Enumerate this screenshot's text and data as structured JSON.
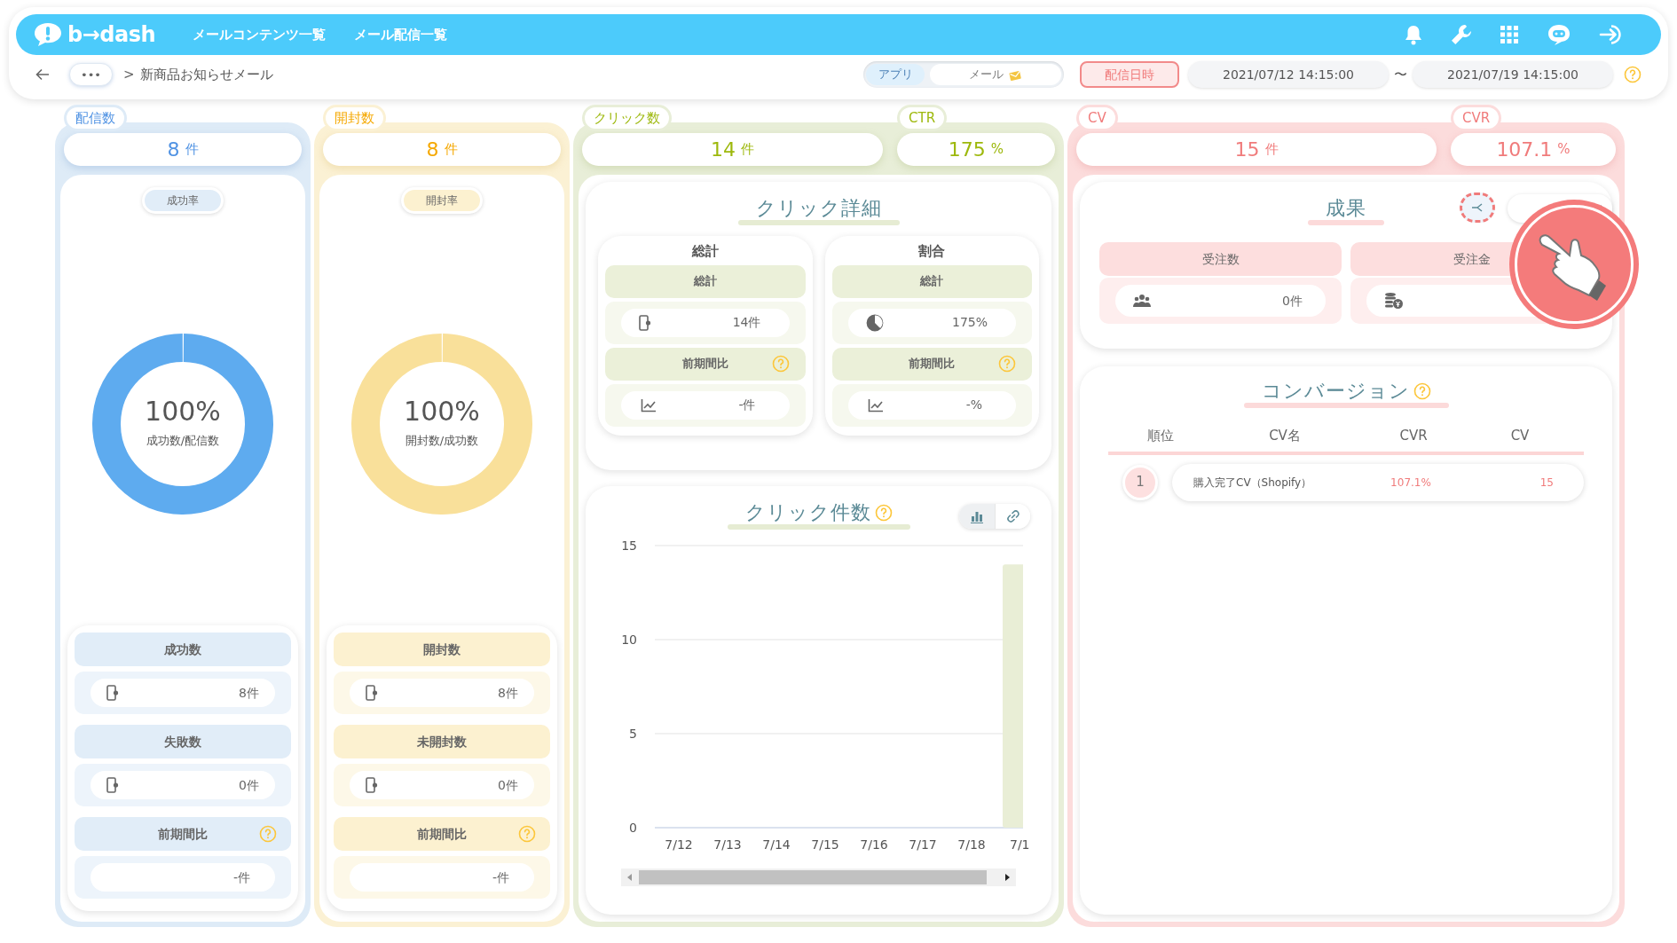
{
  "header": {
    "logo": "b→dash",
    "nav": [
      {
        "label": "メールコンテンツ一覧"
      },
      {
        "label": "メール配信一覧"
      }
    ]
  },
  "breadcrumb": {
    "more": "•••",
    "separator": ">",
    "title": "新商品お知らせメール"
  },
  "channels": [
    {
      "label": "アプリ",
      "selected": true
    },
    {
      "label": "メール",
      "selected": false
    }
  ],
  "period": {
    "button": "配信日時",
    "from": "2021/07/12 14:15:00",
    "separator": "〜",
    "to": "2021/07/19 14:15:00"
  },
  "columns": [
    {
      "kind": "donut",
      "metrics": [
        {
          "label": "配信数",
          "value": "8",
          "unit": "件"
        }
      ],
      "rate_label": "成功率",
      "donut": {
        "level": 1,
        "value": "100%",
        "caption": "成功数/配信数"
      },
      "rows": [
        {
          "kind": "count",
          "label": "成功数",
          "value": "8件"
        },
        {
          "kind": "count",
          "label": "失敗数",
          "value": "0件"
        },
        {
          "kind": "comparison",
          "label": "前期間比",
          "value": "-件"
        }
      ]
    },
    {
      "kind": "donut",
      "metrics": [
        {
          "label": "開封数",
          "value": "8",
          "unit": "件"
        }
      ],
      "rate_label": "開封率",
      "donut": {
        "level": 1,
        "value": "100%",
        "caption": "開封数/成功数"
      },
      "rows": [
        {
          "kind": "count",
          "label": "開封数",
          "value": "8件"
        },
        {
          "kind": "count",
          "label": "未開封数",
          "value": "0件"
        },
        {
          "kind": "comparison",
          "label": "前期間比",
          "value": "-件"
        }
      ]
    },
    {
      "kind": "clicks",
      "metrics": [
        {
          "label": "クリック数",
          "value": "14",
          "unit": "件"
        },
        {
          "label": "CTR",
          "value": "175",
          "unit": "%"
        }
      ],
      "detail": {
        "title": "クリック詳細",
        "groups": [
          {
            "kind": "count",
            "title": "総計",
            "header": "総計",
            "value": "14件",
            "compare_label": "前期間比",
            "compare_value": "-件"
          },
          {
            "kind": "ratio",
            "title": "割合",
            "header": "総計",
            "value": "175%",
            "compare_label": "前期間比",
            "compare_value": "-%"
          }
        ]
      },
      "chart": {
        "views": [
          {
            "kind": "bar",
            "selected": true
          },
          {
            "kind": "link",
            "selected": false
          }
        ],
        "chart_data": {
          "type": "bar",
          "title": "クリック件数",
          "categories": [
            "7/12",
            "7/13",
            "7/14",
            "7/15",
            "7/16",
            "7/17",
            "7/18",
            "7/1"
          ],
          "series": [
            {
              "color": "#e9eed6",
              "values": [
                0,
                0,
                0,
                0,
                0,
                0,
                0,
                14
              ]
            }
          ],
          "ylim": [
            0,
            15
          ],
          "yticks": [
            0,
            5,
            10,
            15
          ]
        }
      }
    },
    {
      "kind": "results",
      "metrics": [
        {
          "label": "CV",
          "value": "15",
          "unit": "件"
        },
        {
          "label": "CVR",
          "value": "107.1",
          "unit": "%"
        }
      ],
      "results": {
        "title": "成果",
        "cards": [
          {
            "kind": "orders",
            "label": "受注数",
            "value": "0件"
          },
          {
            "kind": "sales",
            "label": "受注金"
          }
        ]
      },
      "conversions": {
        "title": "コンバージョン",
        "columns": [
          "順位",
          "CV名",
          "CVR",
          "CV"
        ],
        "rows": [
          {
            "rank": "1",
            "name": "購入完了CV（Shopify）",
            "cvr": "107.1%",
            "cv": "15"
          }
        ]
      }
    }
  ]
}
